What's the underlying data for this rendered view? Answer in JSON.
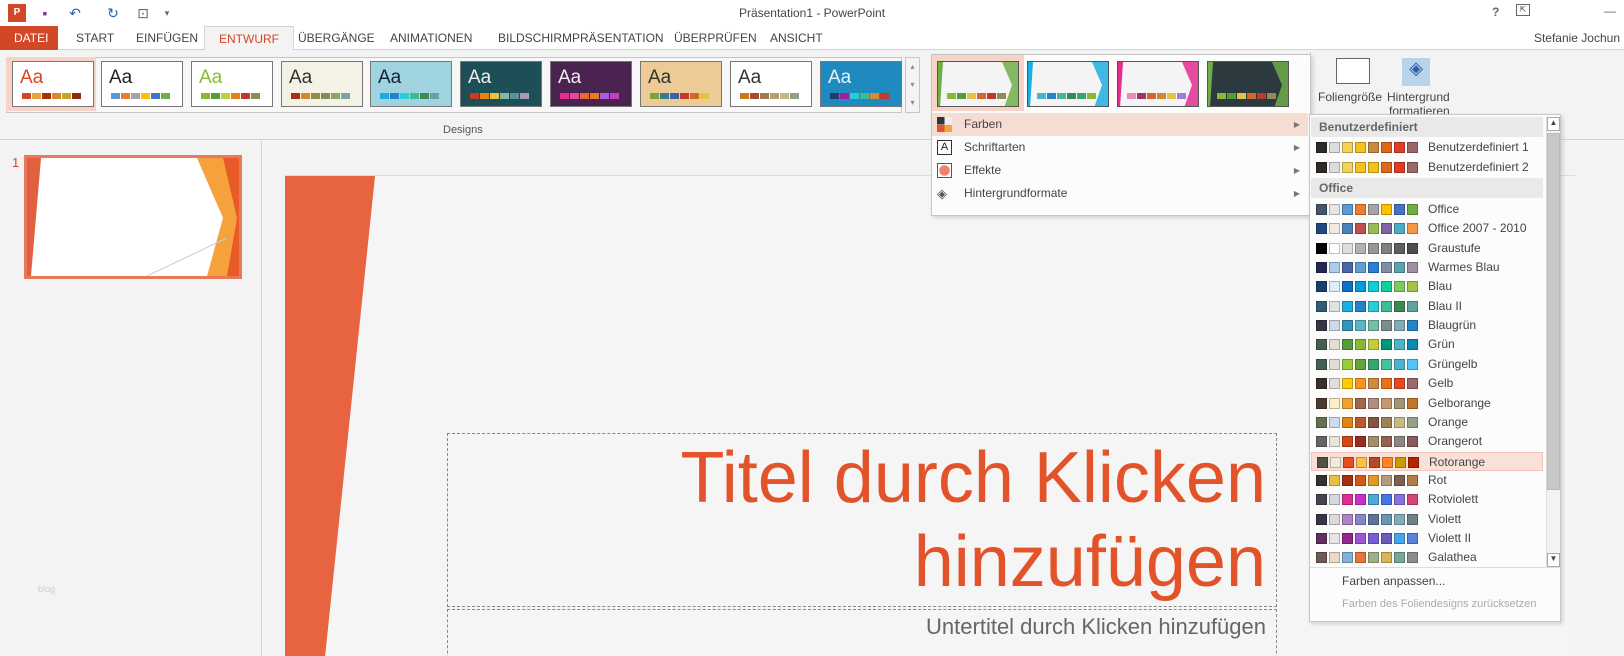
{
  "window": {
    "title": "Präsentation1 - PowerPoint",
    "user": "Stefanie Jochun",
    "help": "?",
    "minimize": "—"
  },
  "tabs": [
    "DATEI",
    "START",
    "EINFÜGEN",
    "ENTWURF",
    "ÜBERGÄNGE",
    "ANIMATIONEN",
    "BILDSCHIRMPRÄSENTATION",
    "ÜBERPRÜFEN",
    "ANSICHT"
  ],
  "ribbon": {
    "designs_label": "Designs",
    "slide_size": "Foliengröße",
    "format_bg_1": "Hintergrund",
    "format_bg_2": "formatieren",
    "themes": [
      {
        "aa": "Aa",
        "bg": "#fff",
        "fg": "#d24726",
        "sw": [
          "#d24726",
          "#e8a33c",
          "#a5300f",
          "#d0892b",
          "#c8a32c",
          "#8b2b0f"
        ]
      },
      {
        "aa": "Aa",
        "bg": "#fff",
        "fg": "#222",
        "sw": [
          "#5b9bd5",
          "#ed7d31",
          "#a5a5a5",
          "#ffc000",
          "#4472c4",
          "#70ad47"
        ]
      },
      {
        "aa": "Aa",
        "bg": "#fff",
        "fg": "#8ab833",
        "sw": [
          "#8ab833",
          "#549e39",
          "#c0cf3a",
          "#e48312",
          "#c0392b",
          "#948a54"
        ]
      },
      {
        "aa": "Aa",
        "bg": "#f3f2e4",
        "fg": "#333",
        "sw": [
          "#a5300f",
          "#d0892b",
          "#948a54",
          "#7f8f52",
          "#8aa36b",
          "#76a4a8"
        ]
      },
      {
        "aa": "Aa",
        "bg": "#9fd3e0",
        "fg": "#123",
        "sw": [
          "#1cade4",
          "#2683c6",
          "#27ced7",
          "#42ba97",
          "#3e8853",
          "#62a39f"
        ]
      },
      {
        "aa": "Aa",
        "bg": "#1d4f57",
        "fg": "#eee",
        "sw": [
          "#c0392b",
          "#e48312",
          "#e5c243",
          "#8ab8a8",
          "#5d8fa0",
          "#a89bb0"
        ]
      },
      {
        "aa": "Aa",
        "bg": "#4a2350",
        "fg": "#eee",
        "sw": [
          "#e32d91",
          "#e0479e",
          "#e8683a",
          "#e87c22",
          "#a95de0",
          "#c040c0"
        ]
      },
      {
        "aa": "Aa",
        "bg": "#eccb96",
        "fg": "#333",
        "sw": [
          "#7fa23c",
          "#3a7e8e",
          "#3a63a5",
          "#c0392b",
          "#d0692b",
          "#e5c243"
        ]
      },
      {
        "aa": "Aa",
        "bg": "#fff",
        "fg": "#333",
        "sw": [
          "#c8791b",
          "#a54d2e",
          "#a07a4e",
          "#b6a079",
          "#c2bc80",
          "#94a088"
        ]
      },
      {
        "aa": "Aa",
        "bg": "#1f8ac0",
        "fg": "#e8f4fa",
        "sw": [
          "#17406d",
          "#a020a0",
          "#27ced7",
          "#42ba97",
          "#d5893b",
          "#c0392b"
        ]
      }
    ]
  },
  "variants": [
    {
      "bg": "#f4f4f4",
      "accent": "#70ad47",
      "sw": [
        "#8ab833",
        "#549e39",
        "#e5c243",
        "#d0692b",
        "#c0392b",
        "#948a54"
      ]
    },
    {
      "bg": "#f4f4f4",
      "accent": "#1cade4",
      "sw": [
        "#4eb3cf",
        "#2683c6",
        "#42ba97",
        "#3e8853",
        "#37a76f",
        "#8ab833"
      ]
    },
    {
      "bg": "#f4f4f4",
      "accent": "#e32d91",
      "sw": [
        "#e98ab9",
        "#a5306b",
        "#d0692b",
        "#d0892b",
        "#e5c243",
        "#a07ad6"
      ]
    },
    {
      "bg": "#2c3a40",
      "accent": "#70ad47",
      "sw": [
        "#8ab833",
        "#549e39",
        "#e5c243",
        "#d0692b",
        "#c0392b",
        "#948a54"
      ]
    }
  ],
  "design_menu": {
    "items": [
      {
        "label": "Farben",
        "icon": "colors-icon"
      },
      {
        "label": "Schriftarten",
        "icon": "fonts-icon"
      },
      {
        "label": "Effekte",
        "icon": "effects-icon"
      },
      {
        "label": "Hintergrundformate",
        "icon": "background-styles-icon"
      }
    ]
  },
  "colors_menu": {
    "custom_header": "Benutzerdefiniert",
    "office_header": "Office",
    "custom": [
      {
        "name": "Benutzerdefiniert 1",
        "colors": [
          "#2e2a27",
          "#dcdcdc",
          "#f3d25a",
          "#f5c11a",
          "#cc8a3b",
          "#e0661c",
          "#dd3d26",
          "#9a6868"
        ]
      },
      {
        "name": "Benutzerdefiniert 2",
        "colors": [
          "#2e2a27",
          "#dcdcdc",
          "#f3d25a",
          "#f5c11a",
          "#f5c11a",
          "#e0661c",
          "#dd3d26",
          "#9a6868"
        ]
      }
    ],
    "office": [
      {
        "name": "Office",
        "colors": [
          "#44546a",
          "#e7e6e6",
          "#5b9bd5",
          "#ed7d31",
          "#a5a5a5",
          "#ffc000",
          "#4472c4",
          "#70ad47"
        ]
      },
      {
        "name": "Office 2007 - 2010",
        "colors": [
          "#1f497d",
          "#eeece1",
          "#4f81bd",
          "#c0504d",
          "#9bbb59",
          "#8064a2",
          "#4bacc6",
          "#f79646"
        ]
      },
      {
        "name": "Graustufe",
        "colors": [
          "#000000",
          "#ffffff",
          "#dddddd",
          "#b2b2b2",
          "#969696",
          "#808080",
          "#5f5f5f",
          "#4d4d4d"
        ]
      },
      {
        "name": "Warmes Blau",
        "colors": [
          "#242852",
          "#acccea",
          "#4a66ac",
          "#629dd1",
          "#297fd5",
          "#7f8fa9",
          "#5aa2ae",
          "#9d90a0"
        ]
      },
      {
        "name": "Blau",
        "colors": [
          "#17406d",
          "#dbeff9",
          "#0f6fc6",
          "#009dd9",
          "#0bd0d9",
          "#10cf9b",
          "#7cca62",
          "#a5c249"
        ]
      },
      {
        "name": "Blau II",
        "colors": [
          "#335b74",
          "#dfe3e5",
          "#1cade4",
          "#2683c6",
          "#27ced7",
          "#42ba97",
          "#3e8853",
          "#62a39f"
        ]
      },
      {
        "name": "Blaugrün",
        "colors": [
          "#373545",
          "#cedbe6",
          "#3494ba",
          "#58b6c0",
          "#75bda7",
          "#7a8c8e",
          "#84acb6",
          "#2683c6"
        ]
      },
      {
        "name": "Grün",
        "colors": [
          "#455f51",
          "#e3ded1",
          "#549e39",
          "#8ab833",
          "#c0cf3a",
          "#029676",
          "#4ab5c4",
          "#0989b1"
        ]
      },
      {
        "name": "Grüngelb",
        "colors": [
          "#455f51",
          "#e3ded1",
          "#99cb38",
          "#63a537",
          "#37a76f",
          "#44c1a3",
          "#4eb3cf",
          "#51c3f9"
        ]
      },
      {
        "name": "Gelb",
        "colors": [
          "#39302a",
          "#e5dedb",
          "#ffca08",
          "#f8931d",
          "#ce8d3e",
          "#ec7016",
          "#e64823",
          "#9c6a6a"
        ]
      },
      {
        "name": "Gelborange",
        "colors": [
          "#4e3b30",
          "#fbeec9",
          "#f0a22e",
          "#a5644e",
          "#b58b80",
          "#c3986d",
          "#a19574",
          "#c17529"
        ]
      },
      {
        "name": "Orange",
        "colors": [
          "#637052",
          "#ccddea",
          "#e48312",
          "#bd582c",
          "#865640",
          "#9b8357",
          "#c2bc80",
          "#94a088"
        ]
      },
      {
        "name": "Orangerot",
        "colors": [
          "#696464",
          "#e9e5dc",
          "#d34817",
          "#9b2d1f",
          "#a28e6a",
          "#956251",
          "#918485",
          "#855d5d"
        ]
      },
      {
        "name": "Rotorange",
        "colors": [
          "#505046",
          "#eeece1",
          "#e84c22",
          "#ffbd47",
          "#b64926",
          "#ff8427",
          "#cc9900",
          "#b22600"
        ],
        "selected": true
      },
      {
        "name": "Rot",
        "colors": [
          "#323232",
          "#e5c243",
          "#a5300f",
          "#d55816",
          "#e19825",
          "#b19c7d",
          "#7f5f52",
          "#b27d49"
        ]
      },
      {
        "name": "Rotviolett",
        "colors": [
          "#454551",
          "#d8d9dc",
          "#e32d91",
          "#c830cc",
          "#4ea6dc",
          "#4775e7",
          "#8971e1",
          "#d54773"
        ]
      },
      {
        "name": "Violett",
        "colors": [
          "#373545",
          "#dcd8dc",
          "#ad84c6",
          "#8784c7",
          "#5d739a",
          "#6997af",
          "#84acb6",
          "#6f8183"
        ]
      },
      {
        "name": "Violett II",
        "colors": [
          "#632e62",
          "#eae5eb",
          "#92278f",
          "#9b57d3",
          "#755dd9",
          "#665eb8",
          "#45a5ed",
          "#5982db"
        ]
      },
      {
        "name": "Galathea",
        "colors": [
          "#6f5a55",
          "#eadcc4",
          "#7fb2d6",
          "#e87437",
          "#9cb084",
          "#d9b45a",
          "#73a89a",
          "#8c8c8c"
        ]
      }
    ],
    "customize": "Farben anpassen...",
    "reset": "Farben des Foliendesigns zurücksetzen"
  },
  "thumbs": {
    "number": "1",
    "watermark": "blog"
  },
  "slide": {
    "title": "Titel durch Klicken hinzufügen",
    "subtitle": "Untertitel durch Klicken hinzufügen",
    "accent": "#d24726"
  }
}
